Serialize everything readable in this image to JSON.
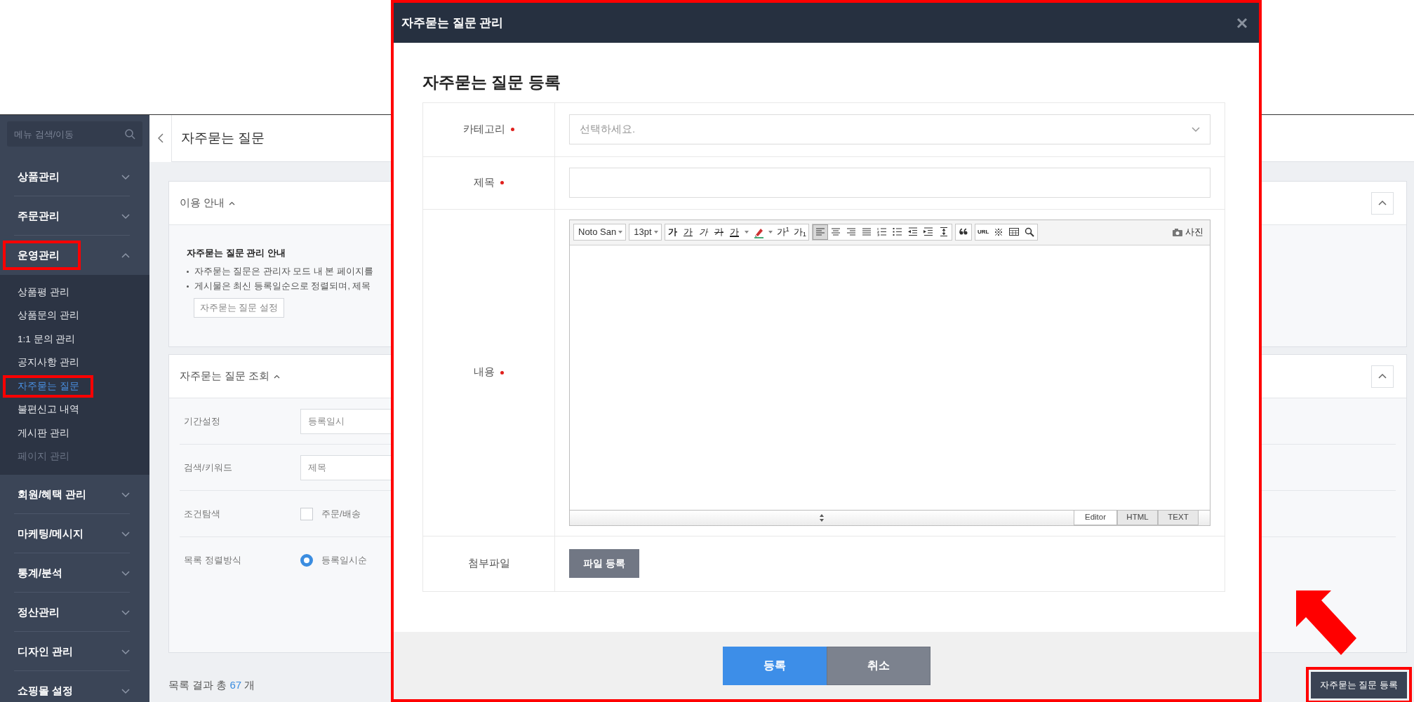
{
  "sidebar": {
    "search_placeholder": "메뉴 검색/이동",
    "menus": [
      {
        "label": "상품관리",
        "expanded": false,
        "highlighted": false
      },
      {
        "label": "주문관리",
        "expanded": false,
        "highlighted": false
      },
      {
        "label": "운영관리",
        "expanded": true,
        "highlighted": true,
        "children": [
          {
            "label": "상품평 관리",
            "selected": false,
            "disabled": false,
            "highlighted": false
          },
          {
            "label": "상품문의 관리",
            "selected": false,
            "disabled": false,
            "highlighted": false
          },
          {
            "label": "1:1 문의 관리",
            "selected": false,
            "disabled": false,
            "highlighted": false
          },
          {
            "label": "공지사항 관리",
            "selected": false,
            "disabled": false,
            "highlighted": false
          },
          {
            "label": "자주묻는 질문",
            "selected": true,
            "disabled": false,
            "highlighted": true
          },
          {
            "label": "불편신고 내역",
            "selected": false,
            "disabled": false,
            "highlighted": false
          },
          {
            "label": "게시판 관리",
            "selected": false,
            "disabled": false,
            "highlighted": false
          },
          {
            "label": "페이지 관리",
            "selected": false,
            "disabled": true,
            "highlighted": false
          }
        ]
      },
      {
        "label": "회원/혜택 관리",
        "expanded": false,
        "highlighted": false
      },
      {
        "label": "마케팅/메시지",
        "expanded": false,
        "highlighted": false
      },
      {
        "label": "통계/분석",
        "expanded": false,
        "highlighted": false
      },
      {
        "label": "정산관리",
        "expanded": false,
        "highlighted": false
      },
      {
        "label": "디자인 관리",
        "expanded": false,
        "highlighted": false
      },
      {
        "label": "쇼핑몰 설정",
        "expanded": false,
        "highlighted": false
      }
    ]
  },
  "page": {
    "title": "자주묻는 질문",
    "guide_card": {
      "title": "이용 안내",
      "expanded": true,
      "heading": "자주묻는 질문 관리 안내",
      "bullets": [
        "자주묻는 질문은 관리자 모드 내 본 페이지를",
        "게시물은 최신 등록일순으로 정렬되며, 제목"
      ],
      "button": "자주묻는 질문 설정"
    },
    "search_card": {
      "title": "자주묻는 질문 조회",
      "expanded": true,
      "rows": [
        {
          "label": "기간설정",
          "kind": "field",
          "value": "등록일시"
        },
        {
          "label": "검색/키워드",
          "kind": "field",
          "value": "제목"
        },
        {
          "label": "조건탐색",
          "kind": "checkbox",
          "option": "주문/배송",
          "checked": false
        },
        {
          "label": "목록 정렬방식",
          "kind": "radio",
          "option": "등록일시순",
          "selected": true
        }
      ]
    },
    "result": "목록 결과 총 **67** 개",
    "register_button": {
      "label": "자주묻는 질문 등록",
      "highlighted": true
    }
  },
  "modal": {
    "title": "자주묻는 질문 관리",
    "highlighted": true,
    "heading": "자주묻는 질문 등록",
    "fields": [
      {
        "label": "카테고리",
        "required": true,
        "kind": "select",
        "placeholder": "선택하세요."
      },
      {
        "label": "제목",
        "required": true,
        "kind": "input"
      },
      {
        "label": "내용",
        "required": true,
        "kind": "editor"
      },
      {
        "label": "첨부파일",
        "required": false,
        "kind": "file",
        "button": "파일 등록"
      }
    ],
    "editor": {
      "font": "Noto San",
      "size": "13pt",
      "tools": [
        {
          "kind": "bold",
          "label": "가",
          "selected": false
        },
        {
          "kind": "underline",
          "label": "가",
          "selected": false
        },
        {
          "kind": "italic",
          "label": "가",
          "selected": false
        },
        {
          "kind": "strike",
          "label": "가",
          "selected": false
        },
        {
          "kind": "font-color",
          "label": "가",
          "selected": false
        },
        {
          "kind": "highlight",
          "selected": false
        },
        {
          "kind": "superscript",
          "label": "가$^{1}$",
          "selected": false
        },
        {
          "kind": "subscript",
          "label": "가$_{1}$",
          "selected": false
        },
        {
          "kind": "align-left",
          "selected": true
        },
        {
          "kind": "align-center",
          "selected": false
        },
        {
          "kind": "align-right",
          "selected": false
        },
        {
          "kind": "justify",
          "selected": false
        },
        {
          "kind": "ordered-list",
          "selected": false
        },
        {
          "kind": "bullet-list",
          "selected": false
        },
        {
          "kind": "outdent",
          "selected": false
        },
        {
          "kind": "indent",
          "selected": false
        },
        {
          "kind": "line-height",
          "selected": false
        },
        {
          "kind": "quote",
          "selected": false
        },
        {
          "kind": "link",
          "label": "URL",
          "selected": false
        },
        {
          "kind": "symbol",
          "label": "※",
          "selected": false
        },
        {
          "kind": "table",
          "selected": false
        },
        {
          "kind": "find",
          "selected": false
        }
      ],
      "photo_label": "사진",
      "tabs": [
        {
          "label": "Editor",
          "selected": true
        },
        {
          "label": "HTML",
          "selected": false
        },
        {
          "label": "TEXT",
          "selected": false
        }
      ]
    },
    "buttons": [
      {
        "label": "등록",
        "kind": "primary"
      },
      {
        "label": "취소",
        "kind": "secondary"
      }
    ]
  }
}
